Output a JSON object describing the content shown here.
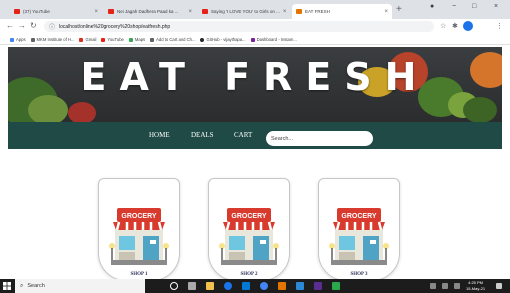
{
  "browser": {
    "tabs": [
      {
        "label": "(37) YouTube",
        "icon": "youtube-icon"
      },
      {
        "label": "Nei Jagah Dadhera Paad ka ...",
        "icon": "youtube-icon"
      },
      {
        "label": "Saying 'I LOVE YOU' to Girls on ...",
        "icon": "youtube-icon"
      },
      {
        "label": "EAT FRESH",
        "icon": "page-icon",
        "active": true
      }
    ],
    "url": "localhost/online%20grocery%20shop/eatfresh.php",
    "bookmarks": [
      "Apps",
      "MKM Institute of H...",
      "Gmail",
      "YouTube",
      "Maps",
      "Add to Cart and Ch...",
      "GitHub - vijaythapa...",
      "Dashboard - Instam..."
    ]
  },
  "page": {
    "title": "EAT FRESH",
    "nav": {
      "home": "HOME",
      "deals": "DEALS",
      "cart": "CART"
    },
    "search": {
      "placeholder": "Search..."
    },
    "shops": [
      {
        "label": "SHOP 1",
        "sign": "GROCERY"
      },
      {
        "label": "SHOP 2",
        "sign": "GROCERY"
      },
      {
        "label": "SHOP 3",
        "sign": "GROCERY"
      }
    ]
  },
  "taskbar": {
    "search_label": "Search",
    "time": "4:25 PM",
    "date": "15-May-21"
  },
  "colors": {
    "navbar": "#1f4a45",
    "hero": "#2f3132",
    "awning": "#d93a2e",
    "sign": "#d93a2e"
  }
}
